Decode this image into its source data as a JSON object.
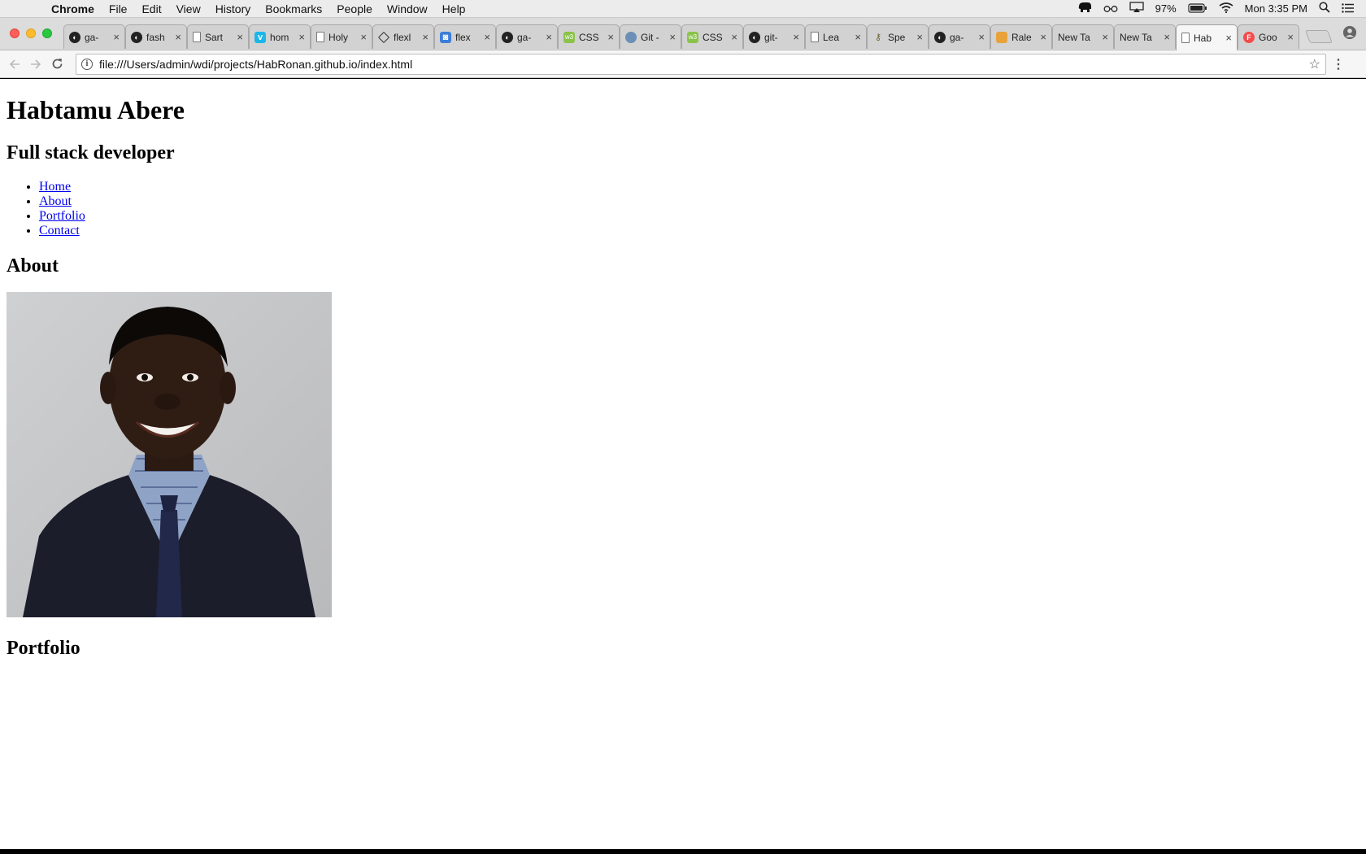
{
  "menubar": {
    "app": "Chrome",
    "items": [
      "File",
      "Edit",
      "View",
      "History",
      "Bookmarks",
      "People",
      "Window",
      "Help"
    ],
    "battery": "97%",
    "clock": "Mon 3:35 PM"
  },
  "tabs": [
    {
      "favicon": "github-icon",
      "title": "ga-"
    },
    {
      "favicon": "github-icon",
      "title": "fash"
    },
    {
      "favicon": "document-icon",
      "title": "Sart"
    },
    {
      "favicon": "vimeo-icon",
      "title": "hom"
    },
    {
      "favicon": "document-icon",
      "title": "Holy"
    },
    {
      "favicon": "codepen-icon",
      "title": "flexl"
    },
    {
      "favicon": "blue-app-icon",
      "title": "flex"
    },
    {
      "favicon": "github-icon",
      "title": "ga-"
    },
    {
      "favicon": "w3c-icon",
      "title": "CSS"
    },
    {
      "favicon": "database-icon",
      "title": "Git -"
    },
    {
      "favicon": "w3c-icon",
      "title": "CSS"
    },
    {
      "favicon": "github-icon",
      "title": "git-"
    },
    {
      "favicon": "document-icon",
      "title": "Lea"
    },
    {
      "favicon": "key-icon",
      "title": "Spe"
    },
    {
      "favicon": "github-icon",
      "title": "ga-"
    },
    {
      "favicon": "fox-icon",
      "title": "Rale"
    },
    {
      "favicon": "",
      "title": "New Ta"
    },
    {
      "favicon": "",
      "title": "New Ta"
    },
    {
      "favicon": "document-icon",
      "title": "Hab",
      "active": true
    },
    {
      "favicon": "google-icon",
      "title": "Goo"
    }
  ],
  "omnibox": {
    "url": "file:///Users/admin/wdi/projects/HabRonan.github.io/index.html"
  },
  "page": {
    "name": "Habtamu Abere",
    "subtitle": "Full stack developer",
    "nav": [
      "Home",
      "About",
      "Portfolio",
      "Contact"
    ],
    "about_heading": "About",
    "portfolio_heading": "Portfolio"
  }
}
